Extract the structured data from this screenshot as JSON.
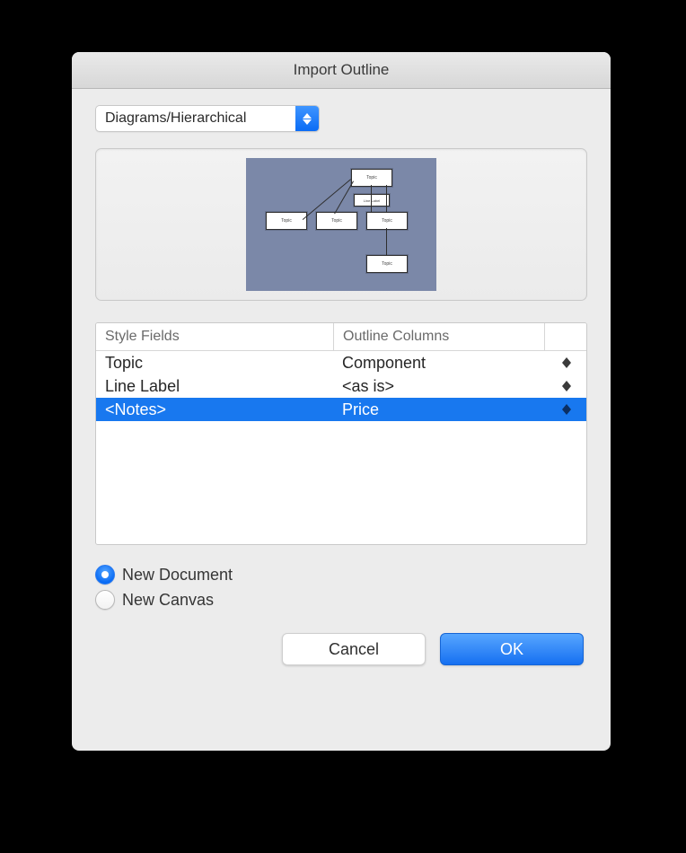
{
  "title": "Import Outline",
  "dropdown": {
    "selected": "Diagrams/Hierarchical"
  },
  "preview": {
    "node_labels": [
      "Topic",
      "Topic",
      "Topic",
      "Topic",
      "Topic"
    ],
    "mid_label": "Line Label"
  },
  "table": {
    "headers": {
      "a": "Style Fields",
      "b": "Outline Columns"
    },
    "rows": [
      {
        "a": "Topic",
        "b": "Component",
        "selected": false
      },
      {
        "a": "Line Label",
        "b": "<as is>",
        "selected": false
      },
      {
        "a": "<Notes>",
        "b": "Price",
        "selected": true
      }
    ]
  },
  "radios": {
    "new_document": "New Document",
    "new_canvas": "New Canvas",
    "selected": "new_document"
  },
  "buttons": {
    "cancel": "Cancel",
    "ok": "OK"
  }
}
